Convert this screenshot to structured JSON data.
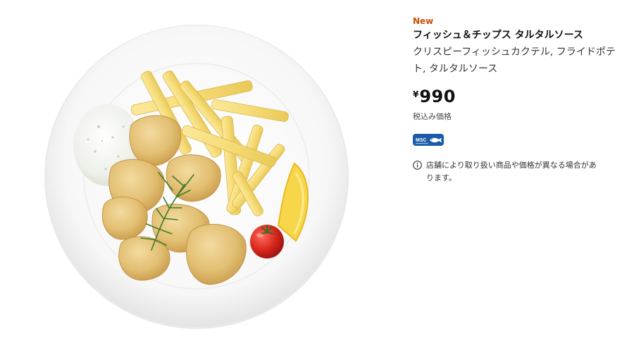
{
  "product": {
    "badge": "New",
    "title": "フィッシュ＆チップス タルタルソース",
    "description": "クリスピーフィッシュカクテル, フライドポテト, タルタルソース",
    "price": {
      "currency": "¥",
      "amount": "990"
    },
    "tax_note": "税込み価格",
    "certification": {
      "label": "MSC",
      "icon": "msc-fish-icon"
    },
    "availability_note": "店舗により取り扱い商品や価格が異なる場合があります。"
  },
  "image": {
    "alt": "Fish and chips plate with tartar sauce, lemon and cherry tomato"
  },
  "colors": {
    "badge": "#ca5008",
    "msc_blue": "#1a5aa6",
    "text": "#111111"
  }
}
